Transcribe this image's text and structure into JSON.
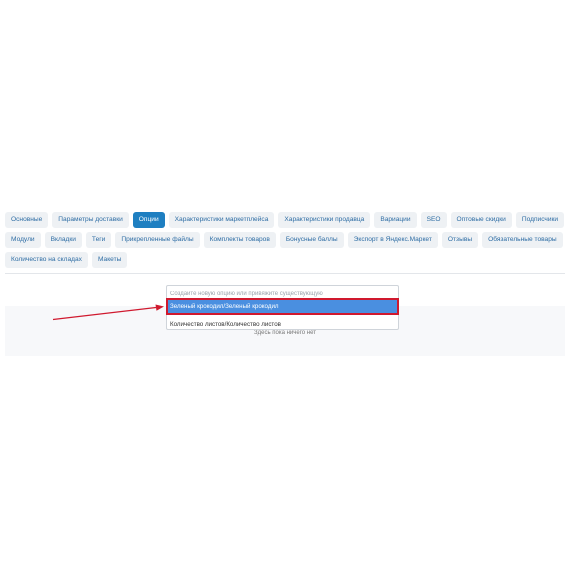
{
  "tabs": [
    {
      "label": "Основные",
      "active": false
    },
    {
      "label": "Параметры доставки",
      "active": false
    },
    {
      "label": "Опции",
      "active": true
    },
    {
      "label": "Характеристики маркетплейса",
      "active": false
    },
    {
      "label": "Характеристики продавца",
      "active": false
    },
    {
      "label": "Вариации",
      "active": false
    },
    {
      "label": "SEO",
      "active": false
    },
    {
      "label": "Оптовые скидки",
      "active": false
    },
    {
      "label": "Подписчики",
      "active": false
    },
    {
      "label": "Модули",
      "active": false
    },
    {
      "label": "Вкладки",
      "active": false
    },
    {
      "label": "Теги",
      "active": false
    },
    {
      "label": "Прикрепленные файлы",
      "active": false
    },
    {
      "label": "Комплекты товаров",
      "active": false
    },
    {
      "label": "Бонусные баллы",
      "active": false
    },
    {
      "label": "Экспорт в Яндекс.Маркет",
      "active": false
    },
    {
      "label": "Отзывы",
      "active": false
    },
    {
      "label": "Обязательные товары",
      "active": false
    },
    {
      "label": "Количество на складах",
      "active": false
    },
    {
      "label": "Макеты",
      "active": false
    }
  ],
  "option_picker": {
    "placeholder": "Создайте новую опцию или привяжите существующую",
    "value": "",
    "options": [
      {
        "label": "Зеленый крокодил/Зеленый крокодил",
        "highlighted": true
      },
      {
        "label": "Количество листов/Количество листов",
        "highlighted": false
      }
    ]
  },
  "empty_message": "Здесь пока ничего нет",
  "colors": {
    "accent": "#1e7fc1",
    "tab_text": "#2e6da4",
    "highlight": "#4a8fe0",
    "annotation": "#d0192e"
  }
}
